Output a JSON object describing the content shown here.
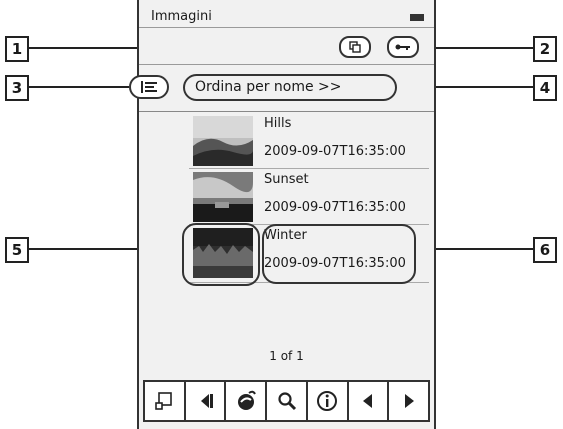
{
  "app": {
    "title": "Immagini"
  },
  "toolbar_top": {
    "copy_icon": "copy-icon",
    "key_icon": "key-icon"
  },
  "sort": {
    "icon": "list-sort-icon",
    "label": "Ordina per nome  >>"
  },
  "items": [
    {
      "name": "Hills",
      "date": "2009-09-07T16:35:00"
    },
    {
      "name": "Sunset",
      "date": "2009-09-07T16:35:00"
    },
    {
      "name": "Winter",
      "date": "2009-09-07T16:35:00"
    }
  ],
  "pager": {
    "text": "1 of 1"
  },
  "bottom_toolbar": [
    {
      "icon": "home-icon"
    },
    {
      "icon": "first-page-icon"
    },
    {
      "icon": "browser-icon"
    },
    {
      "icon": "search-icon"
    },
    {
      "icon": "info-icon"
    },
    {
      "icon": "previous-icon"
    },
    {
      "icon": "next-icon"
    }
  ],
  "callouts": [
    "1",
    "2",
    "3",
    "4",
    "5",
    "6"
  ]
}
